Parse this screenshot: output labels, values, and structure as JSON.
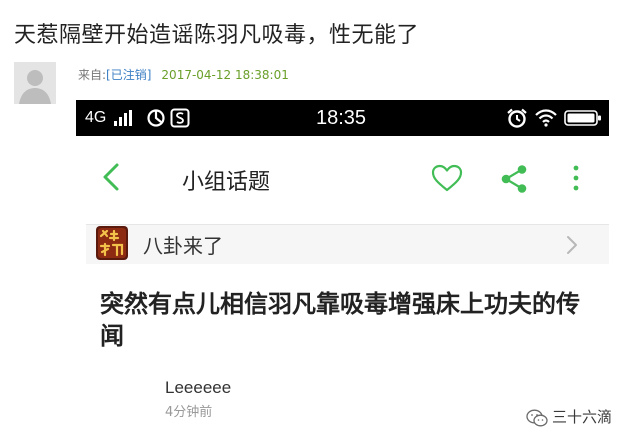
{
  "post": {
    "title": "天惹隔壁开始造谣陈羽凡吸毒，性无能了",
    "from_label": "来自:",
    "from_status": "[已注销]",
    "date": "2017-04-12 18:38:01"
  },
  "phone": {
    "statusbar": {
      "network": "4G",
      "time": "18:35"
    },
    "navbar": {
      "title": "小组话题",
      "accent_color": "#42bd56"
    },
    "group": {
      "name": "八卦来了",
      "avatar_text": "八卦来了"
    },
    "topic": {
      "title": "突然有点儿相信羽凡靠吸毒增强床上功夫的传闻"
    },
    "comment": {
      "author": "Leeeeee",
      "time_ago": "4分钟前"
    }
  },
  "watermark": {
    "text": "三十六滴"
  }
}
